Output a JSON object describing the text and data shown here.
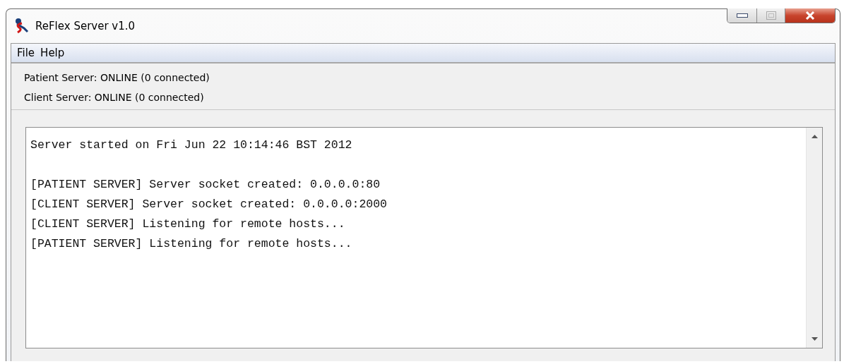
{
  "window": {
    "title": "ReFlex Server v1.0"
  },
  "menu": [
    "File",
    "Help"
  ],
  "status_lines": [
    "Patient Server: ONLINE (0 connected)",
    "Client Server: ONLINE (0 connected)"
  ],
  "log": {
    "blocks": [
      [
        "Server started on Fri Jun 22 10:14:46 BST 2012"
      ],
      [
        "[PATIENT SERVER] Server socket created: 0.0.0.0:80",
        "[CLIENT SERVER] Server socket created: 0.0.0.0:2000",
        "[CLIENT SERVER] Listening for remote hosts...",
        "[PATIENT SERVER] Listening for remote hosts..."
      ]
    ]
  }
}
